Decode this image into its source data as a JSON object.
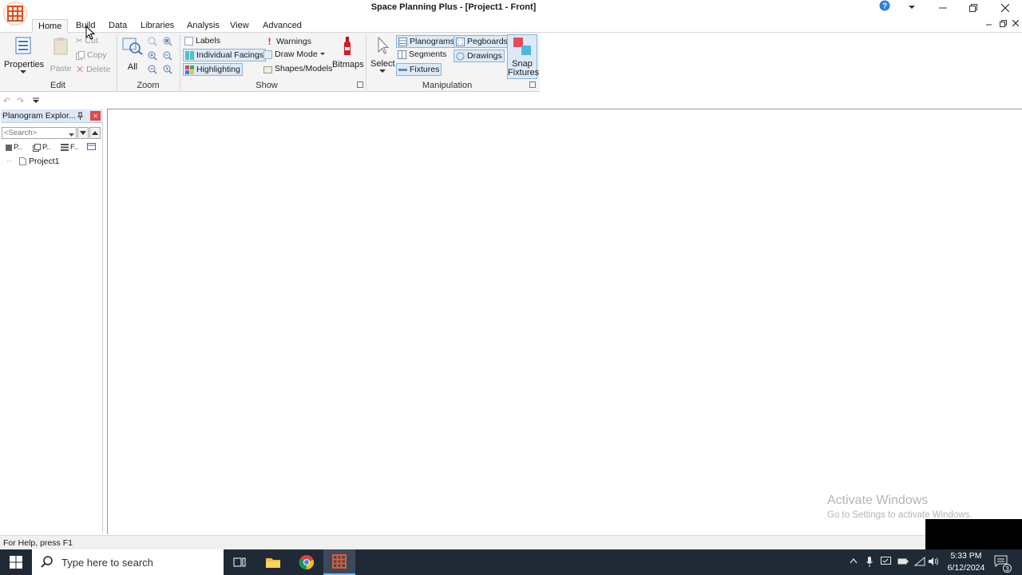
{
  "window": {
    "title": "Space Planning Plus - [Project1 - Front]"
  },
  "menu": {
    "tabs": [
      "Home",
      "Build",
      "Data",
      "Libraries",
      "Analysis",
      "View",
      "Advanced"
    ],
    "active_tab": "Home"
  },
  "ribbon": {
    "edit": {
      "label": "Edit",
      "properties": "Properties",
      "paste": "Paste",
      "cut": "Cut",
      "copy": "Copy",
      "delete": "Delete"
    },
    "zoom": {
      "label": "Zoom",
      "all": "All"
    },
    "show": {
      "label": "Show",
      "labels": "Labels",
      "individual_facings": "Individual Facings",
      "highlighting": "Highlighting",
      "warnings": "Warnings",
      "draw_mode": "Draw Mode",
      "shapes_models": "Shapes/Models",
      "bitmaps": "Bitmaps"
    },
    "manipulation": {
      "label": "Manipulation",
      "select": "Select",
      "planograms": "Planograms",
      "segments": "Segments",
      "fixtures": "Fixtures",
      "pegboards": "Pegboards",
      "drawings": "Drawings",
      "snap_fixtures_line1": "Snap",
      "snap_fixtures_line2": "Fixtures"
    }
  },
  "explorer": {
    "title": "Planogram Explor...",
    "search_placeholder": "<Search>",
    "tabs": [
      "P..",
      "P..",
      "F..",
      ""
    ],
    "tree": [
      "Project1"
    ]
  },
  "watermark": {
    "line1": "Activate Windows",
    "line2": "Go to Settings to activate Windows."
  },
  "status": {
    "text": "For Help, press F1"
  },
  "taskbar": {
    "search_placeholder": "Type here to search",
    "time": "5:33 PM",
    "date": "6/12/2024",
    "notification_count": "3"
  },
  "colors": {
    "taskbar": "#1f2a36",
    "selected_bg": "#dceaf7",
    "selected_border": "#89b4de",
    "ribbon_bg": "#f4f4f4"
  }
}
